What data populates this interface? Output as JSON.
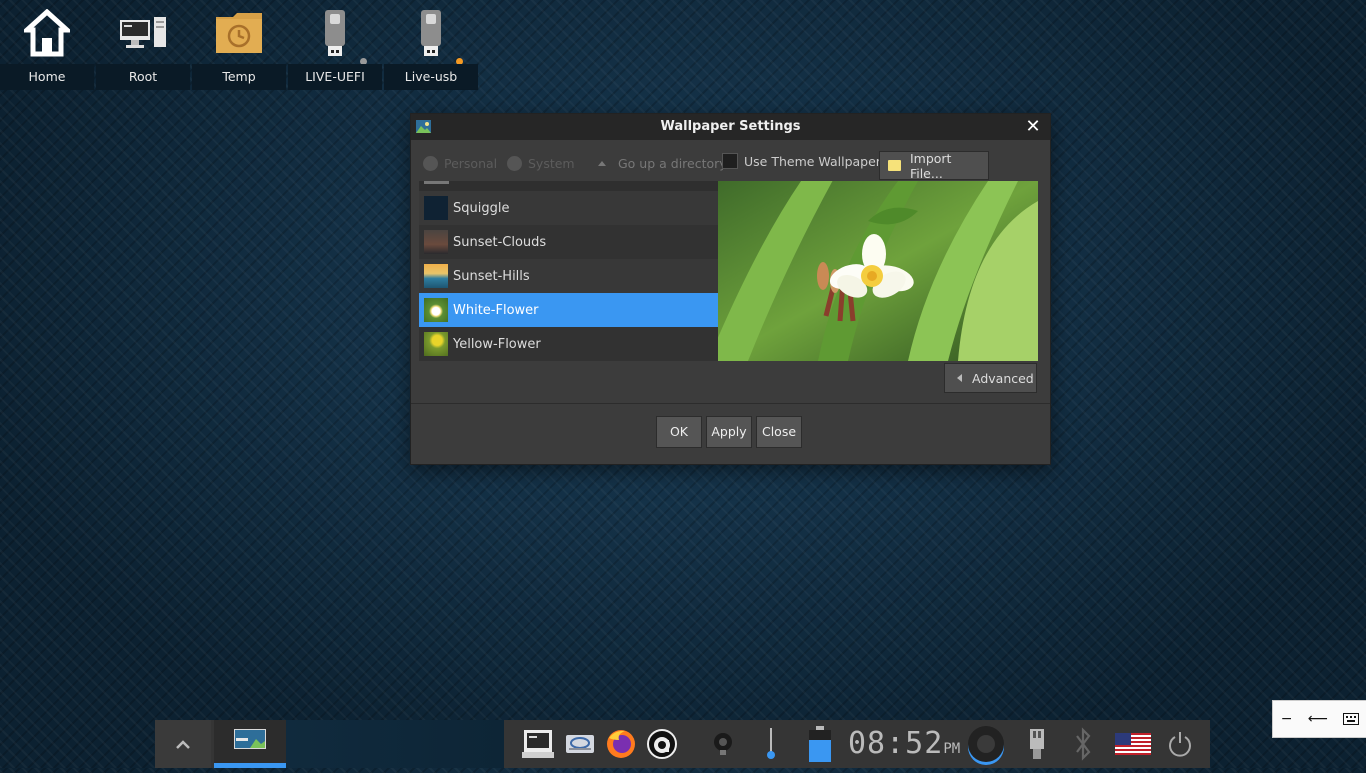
{
  "desktop": {
    "icons": [
      {
        "label": "Home",
        "icon": "home-icon"
      },
      {
        "label": "Root",
        "icon": "computer-icon"
      },
      {
        "label": "Temp",
        "icon": "temp-folder-icon"
      },
      {
        "label": "LIVE-UEFI",
        "icon": "usb-drive-icon",
        "status_color": "#9a9a9a"
      },
      {
        "label": "Live-usb",
        "icon": "usb-drive-icon",
        "status_color": "#f59a23"
      }
    ]
  },
  "dialog": {
    "title": "Wallpaper Settings",
    "sources": {
      "personal": "Personal",
      "system": "System"
    },
    "go_up": "Go up a directory",
    "use_theme": "Use Theme Wallpaper",
    "import": "Import File...",
    "wallpapers": [
      {
        "name": "Squiggle",
        "selected": false
      },
      {
        "name": "Sunset-Clouds",
        "selected": false
      },
      {
        "name": "Sunset-Hills",
        "selected": false
      },
      {
        "name": "White-Flower",
        "selected": true
      },
      {
        "name": "Yellow-Flower",
        "selected": false
      }
    ],
    "advanced": "Advanced",
    "buttons": {
      "ok": "OK",
      "apply": "Apply",
      "close": "Close"
    }
  },
  "taskbar": {
    "clock": {
      "time": "08:52",
      "ampm": "PM"
    },
    "accent_color": "#3a97f2",
    "launchers": [
      "terminal-icon",
      "disk-icon",
      "firefox-icon",
      "appimage-icon"
    ],
    "tray": [
      "brightness-icon",
      "volume-slider-icon",
      "battery-icon",
      "volume-icon",
      "usb-icon",
      "bluetooth-icon",
      "us-flag-icon",
      "power-icon"
    ]
  },
  "mini_window": {
    "buttons": [
      "−",
      "⟵",
      "keyboard-icon"
    ]
  }
}
